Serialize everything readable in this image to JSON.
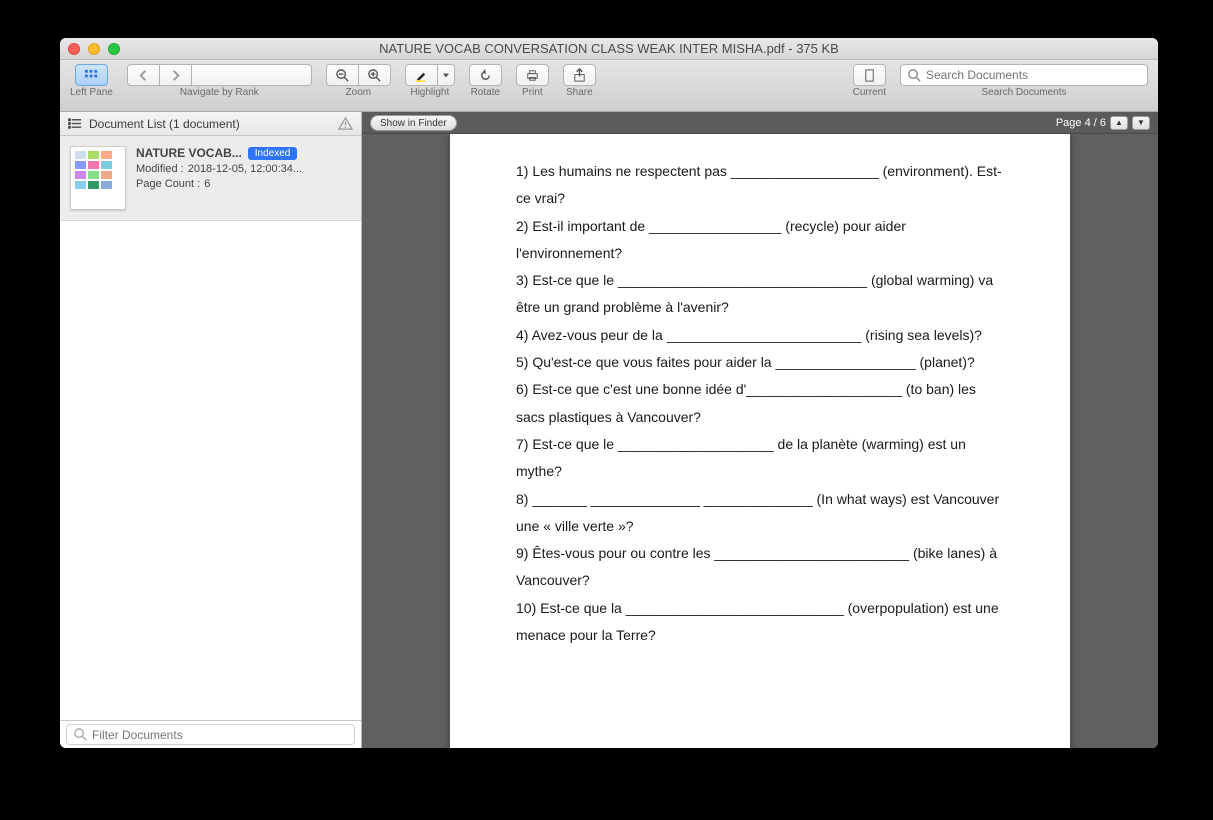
{
  "window": {
    "title": "NATURE VOCAB CONVERSATION CLASS WEAK INTER MISHA.pdf - 375 KB"
  },
  "toolbar": {
    "left_pane_label": "Left Pane",
    "navigate_label": "Navigate by Rank",
    "zoom_label": "Zoom",
    "highlight_label": "Highlight",
    "rotate_label": "Rotate",
    "print_label": "Print",
    "share_label": "Share",
    "current_label": "Current",
    "search_label": "Search Documents",
    "search_placeholder": "Search Documents"
  },
  "sidebar": {
    "header": "Document List (1 document)",
    "doc": {
      "title": "NATURE VOCAB...",
      "badge": "Indexed",
      "modified_label": "Modified :",
      "modified_value": "2018-12-05, 12:00:34...",
      "pagecount_label": "Page Count :",
      "pagecount_value": "6"
    },
    "filter_placeholder": "Filter Documents"
  },
  "content": {
    "show_in_finder": "Show in Finder",
    "page_indicator": "Page 4 / 6",
    "lines": [
      "1) Les humains ne respectent pas ___________________ (environment). Est-ce vrai?",
      "2) Est-il important de _________________ (recycle) pour aider l'environnement?",
      "3) Est-ce que le ________________________________ (global warming) va être un grand problème à l'avenir?",
      "4) Avez-vous peur de la _________________________ (rising sea levels)?",
      "5) Qu'est-ce que vous faites pour aider la __________________ (planet)?",
      "6) Est-ce que c'est une bonne idée d'____________________ (to ban) les sacs plastiques à Vancouver?",
      "7) Est-ce que le ____________________ de la planète (warming) est un mythe?",
      "8) _______ ______________ ______________ (In what ways) est Vancouver une « ville verte »?",
      "9) Êtes-vous pour ou contre les _________________________ (bike lanes) à Vancouver?",
      "10) Est-ce que la ____________________________ (overpopulation) est une menace pour la Terre?"
    ]
  }
}
